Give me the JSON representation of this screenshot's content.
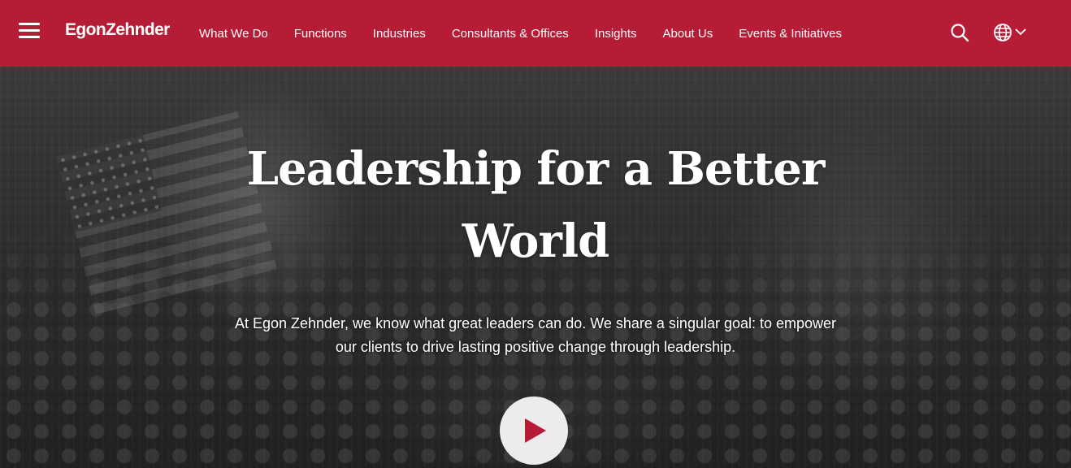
{
  "header": {
    "background_color": "#b71c36",
    "menu_icon": "hamburger-menu-icon",
    "logo_text": "EgonZehnder",
    "nav_items": [
      {
        "label": "What We Do"
      },
      {
        "label": "Functions"
      },
      {
        "label": "Industries"
      },
      {
        "label": "Consultants & Offices"
      },
      {
        "label": "Insights"
      },
      {
        "label": "About Us"
      },
      {
        "label": "Events & Initiatives"
      }
    ],
    "search_icon": "search-icon",
    "language_icon": "globe-icon",
    "language_dropdown_icon": "chevron-down-icon"
  },
  "hero": {
    "title": "Leadership for a Better World",
    "subtitle": "At Egon Zehnder, we know what great leaders can do. We share a singular goal: to empower our clients to drive lasting positive change through leadership.",
    "play_icon": "play-icon",
    "play_button_color": "#ececec",
    "play_icon_color": "#b71c36"
  }
}
